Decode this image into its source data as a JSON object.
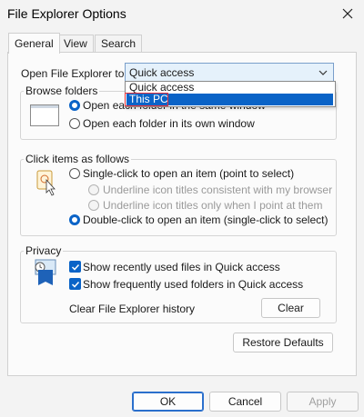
{
  "window": {
    "title": "File Explorer Options"
  },
  "tabs": [
    {
      "label": "General",
      "active": true
    },
    {
      "label": "View",
      "active": false
    },
    {
      "label": "Search",
      "active": false
    }
  ],
  "open_explorer": {
    "label": "Open File Explorer to:",
    "value": "Quick access",
    "options": [
      "Quick access",
      "This PC"
    ],
    "highlighted": "This PC"
  },
  "browse_folders": {
    "title": "Browse folders",
    "options": [
      {
        "label": "Open each folder in the same window",
        "checked": true
      },
      {
        "label": "Open each folder in its own window",
        "checked": false
      }
    ]
  },
  "click_items": {
    "title": "Click items as follows",
    "single_click": "Single-click to open an item (point to select)",
    "underline_browser": "Underline icon titles consistent with my browser",
    "underline_point": "Underline icon titles only when I point at them",
    "double_click": "Double-click to open an item (single-click to select)"
  },
  "privacy": {
    "title": "Privacy",
    "recent_files": "Show recently used files in Quick access",
    "frequent_folders": "Show frequently used folders in Quick access",
    "clear_label": "Clear File Explorer history",
    "clear_button": "Clear"
  },
  "buttons": {
    "restore_defaults": "Restore Defaults",
    "ok": "OK",
    "cancel": "Cancel",
    "apply": "Apply"
  },
  "colors": {
    "accent": "#0a63c7",
    "highlight_border": "#e8343b"
  }
}
